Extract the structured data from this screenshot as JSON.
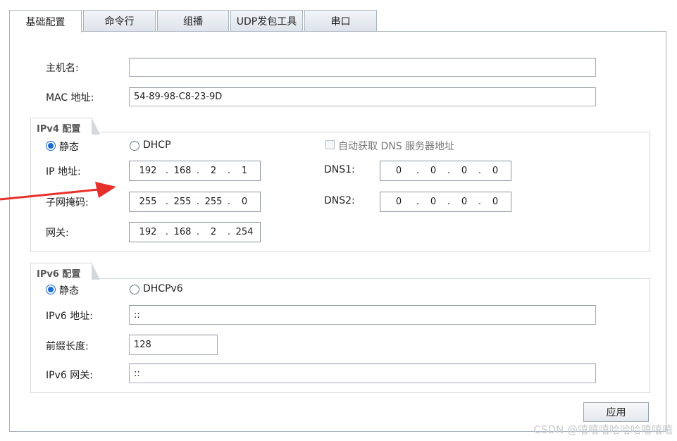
{
  "tabs": [
    {
      "label": "基础配置"
    },
    {
      "label": "命令行"
    },
    {
      "label": "组播"
    },
    {
      "label": "UDP发包工具"
    },
    {
      "label": "串口"
    }
  ],
  "hostname": {
    "label": "主机名:",
    "value": ""
  },
  "mac": {
    "label": "MAC 地址:",
    "value": "54-89-98-C8-23-9D"
  },
  "ipv4": {
    "title": "IPv4 配置",
    "static_label": "静态",
    "dhcp_label": "DHCP",
    "auto_dns_label": "自动获取 DNS 服务器地址",
    "ip_label": "IP 地址:",
    "ip": [
      "192",
      "168",
      "2",
      "1"
    ],
    "mask_label": "子网掩码:",
    "mask": [
      "255",
      "255",
      "255",
      "0"
    ],
    "gateway_label": "网关:",
    "gateway": [
      "192",
      "168",
      "2",
      "254"
    ],
    "dns1_label": "DNS1:",
    "dns1": [
      "0",
      "0",
      "0",
      "0"
    ],
    "dns2_label": "DNS2:",
    "dns2": [
      "0",
      "0",
      "0",
      "0"
    ]
  },
  "ipv6": {
    "title": "IPv6 配置",
    "static_label": "静态",
    "dhcp_label": "DHCPv6",
    "ip_label": "IPv6 地址:",
    "ip_value": "::",
    "prefix_label": "前缀长度:",
    "prefix_value": "128",
    "gateway_label": "IPv6 网关:",
    "gateway_value": "::"
  },
  "apply_label": "应用",
  "watermark": "CSDN @嘻嘻嘻哈哈哈嘻嘻嘻",
  "annotation_arrow": {
    "color": "#e8302a"
  }
}
